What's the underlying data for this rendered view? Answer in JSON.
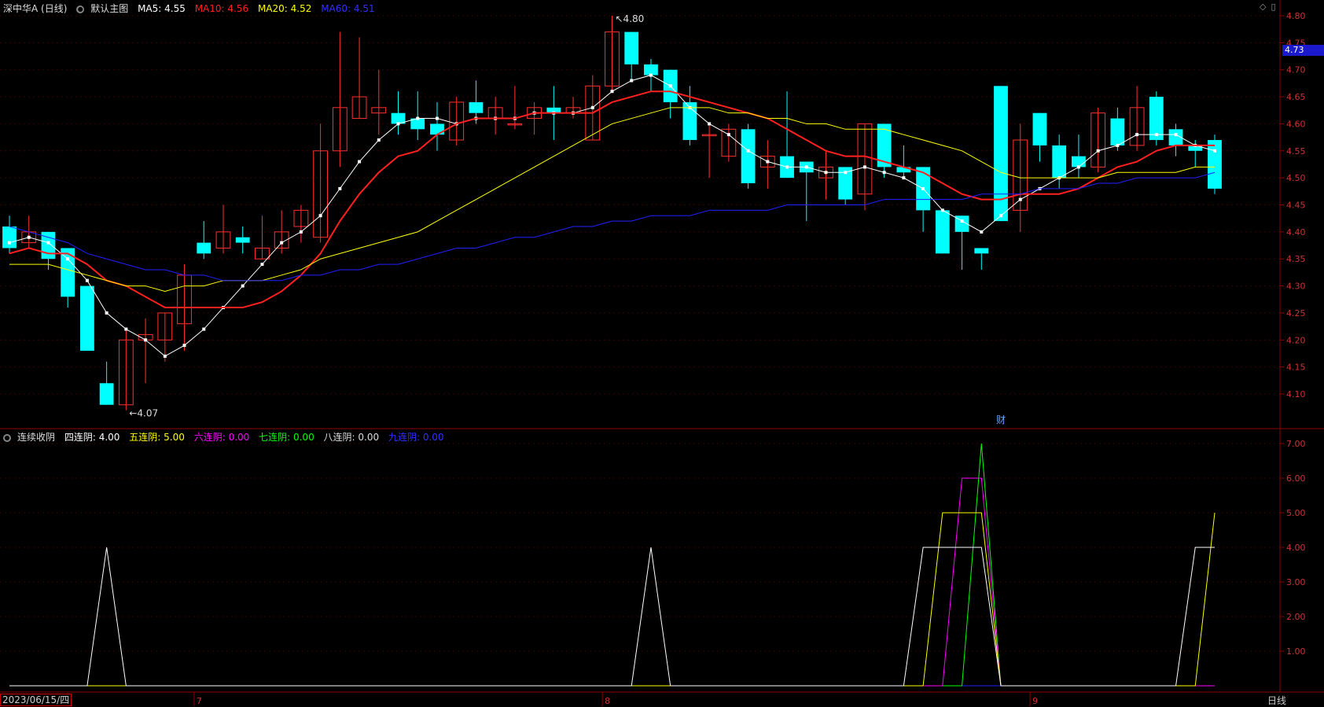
{
  "main": {
    "title": "深中华A (日线)",
    "template": "默认主图",
    "ma": [
      {
        "label": "MA5:",
        "value": "4.55",
        "color": "#ffffff"
      },
      {
        "label": "MA10:",
        "value": "4.56",
        "color": "#ff2020"
      },
      {
        "label": "MA20:",
        "value": "4.52",
        "color": "#ffff00"
      },
      {
        "label": "MA60:",
        "value": "4.51",
        "color": "#2020ff"
      }
    ],
    "current_price_tag": "4.73",
    "finance_marker": "财",
    "high_label": "4.80",
    "low_label": "4.07"
  },
  "indicator": {
    "name": "连续收阴",
    "items": [
      {
        "label": "四连阴:",
        "value": "4.00",
        "color": "#ffffff"
      },
      {
        "label": "五连阴:",
        "value": "5.00",
        "color": "#ffff00"
      },
      {
        "label": "六连阴:",
        "value": "0.00",
        "color": "#ff00ff"
      },
      {
        "label": "七连阴:",
        "value": "0.00",
        "color": "#00ff00"
      },
      {
        "label": "八连阴:",
        "value": "0.00",
        "color": "#ffffff"
      },
      {
        "label": "九连阴:",
        "value": "0.00",
        "color": "#2020ff"
      }
    ]
  },
  "footer": {
    "date": "2023/06/15/四",
    "months": [
      "7",
      "8",
      "9"
    ],
    "period_button": "日线"
  },
  "colors": {
    "up": "#ff3030",
    "down": "#00ffff",
    "grid": "#8b0000",
    "axis_text": "#cc3333"
  },
  "chart_data": [
    {
      "type": "candlestick",
      "title": "深中华A (日线)",
      "ylim": [
        4.07,
        4.8
      ],
      "yticks": [
        "4.80",
        "4.75",
        "4.70",
        "4.65",
        "4.60",
        "4.55",
        "4.50",
        "4.45",
        "4.40",
        "4.35",
        "4.30",
        "4.25",
        "4.20",
        "4.15",
        "4.10"
      ],
      "candles": [
        [
          4.41,
          4.37,
          4.43,
          4.36
        ],
        [
          4.38,
          4.4,
          4.43,
          4.37
        ],
        [
          4.4,
          4.35,
          4.4,
          4.33
        ],
        [
          4.37,
          4.28,
          4.37,
          4.26
        ],
        [
          4.3,
          4.18,
          4.3,
          4.18
        ],
        [
          4.12,
          4.08,
          4.16,
          4.08
        ],
        [
          4.08,
          4.2,
          4.22,
          4.07
        ],
        [
          4.2,
          4.21,
          4.24,
          4.12
        ],
        [
          4.2,
          4.25,
          4.25,
          4.16
        ],
        [
          4.23,
          4.32,
          4.34,
          4.18
        ],
        [
          4.38,
          4.36,
          4.42,
          4.35
        ],
        [
          4.37,
          4.4,
          4.45,
          4.36
        ],
        [
          4.39,
          4.38,
          4.41,
          4.36
        ],
        [
          4.35,
          4.37,
          4.43,
          4.35
        ],
        [
          4.37,
          4.4,
          4.44,
          4.36
        ],
        [
          4.41,
          4.44,
          4.45,
          4.38
        ],
        [
          4.39,
          4.55,
          4.6,
          4.38
        ],
        [
          4.55,
          4.63,
          4.77,
          4.52
        ],
        [
          4.61,
          4.65,
          4.76,
          4.61
        ],
        [
          4.62,
          4.63,
          4.7,
          4.58
        ],
        [
          4.62,
          4.6,
          4.66,
          4.58
        ],
        [
          4.61,
          4.59,
          4.66,
          4.57
        ],
        [
          4.6,
          4.58,
          4.64,
          4.55
        ],
        [
          4.57,
          4.64,
          4.65,
          4.56
        ],
        [
          4.64,
          4.62,
          4.68,
          4.6
        ],
        [
          4.61,
          4.63,
          4.65,
          4.58
        ],
        [
          4.6,
          4.6,
          4.67,
          4.59
        ],
        [
          4.61,
          4.63,
          4.64,
          4.58
        ],
        [
          4.63,
          4.62,
          4.67,
          4.57
        ],
        [
          4.62,
          4.63,
          4.65,
          4.61
        ],
        [
          4.57,
          4.67,
          4.69,
          4.57
        ],
        [
          4.67,
          4.77,
          4.8,
          4.66
        ],
        [
          4.77,
          4.71,
          4.77,
          4.68
        ],
        [
          4.71,
          4.69,
          4.72,
          4.66
        ],
        [
          4.7,
          4.64,
          4.7,
          4.61
        ],
        [
          4.64,
          4.57,
          4.67,
          4.56
        ],
        [
          4.58,
          4.58,
          4.6,
          4.5
        ],
        [
          4.54,
          4.59,
          4.6,
          4.53
        ],
        [
          4.59,
          4.49,
          4.6,
          4.48
        ],
        [
          4.52,
          4.54,
          4.57,
          4.48
        ],
        [
          4.54,
          4.5,
          4.66,
          4.5
        ],
        [
          4.53,
          4.51,
          4.53,
          4.42
        ],
        [
          4.5,
          4.52,
          4.55,
          4.46
        ],
        [
          4.52,
          4.46,
          4.52,
          4.45
        ],
        [
          4.47,
          4.6,
          4.6,
          4.44
        ],
        [
          4.6,
          4.52,
          4.6,
          4.5
        ],
        [
          4.52,
          4.51,
          4.56,
          4.5
        ],
        [
          4.52,
          4.44,
          4.52,
          4.4
        ],
        [
          4.44,
          4.36,
          4.44,
          4.36
        ],
        [
          4.43,
          4.4,
          4.43,
          4.33
        ],
        [
          4.37,
          4.36,
          4.37,
          4.33
        ],
        [
          4.67,
          4.42,
          4.67,
          4.42
        ],
        [
          4.44,
          4.57,
          4.6,
          4.4
        ],
        [
          4.62,
          4.56,
          4.62,
          4.53
        ],
        [
          4.56,
          4.5,
          4.58,
          4.48
        ],
        [
          4.54,
          4.52,
          4.58,
          4.5
        ],
        [
          4.52,
          4.62,
          4.63,
          4.51
        ],
        [
          4.61,
          4.56,
          4.63,
          4.55
        ],
        [
          4.56,
          4.63,
          4.67,
          4.55
        ],
        [
          4.65,
          4.57,
          4.66,
          4.56
        ],
        [
          4.59,
          4.56,
          4.6,
          4.54
        ],
        [
          4.56,
          4.55,
          4.57,
          4.52
        ],
        [
          4.57,
          4.48,
          4.58,
          4.47
        ]
      ],
      "series": [
        {
          "name": "MA5",
          "color": "#ffffff",
          "values": [
            4.38,
            4.39,
            4.38,
            4.35,
            4.31,
            4.25,
            4.22,
            4.2,
            4.17,
            4.19,
            4.22,
            4.26,
            4.3,
            4.34,
            4.38,
            4.4,
            4.43,
            4.48,
            4.53,
            4.57,
            4.6,
            4.61,
            4.61,
            4.6,
            4.61,
            4.61,
            4.61,
            4.62,
            4.62,
            4.62,
            4.63,
            4.66,
            4.68,
            4.69,
            4.67,
            4.63,
            4.6,
            4.58,
            4.55,
            4.53,
            4.52,
            4.52,
            4.51,
            4.51,
            4.52,
            4.51,
            4.5,
            4.48,
            4.44,
            4.42,
            4.4,
            4.43,
            4.46,
            4.48,
            4.5,
            4.52,
            4.55,
            4.56,
            4.58,
            4.58,
            4.58,
            4.56,
            4.55
          ]
        },
        {
          "name": "MA10",
          "color": "#ff2020",
          "values": [
            4.36,
            4.37,
            4.36,
            4.36,
            4.34,
            4.31,
            4.3,
            4.28,
            4.26,
            4.26,
            4.26,
            4.26,
            4.26,
            4.27,
            4.29,
            4.32,
            4.36,
            4.42,
            4.47,
            4.51,
            4.54,
            4.55,
            4.58,
            4.6,
            4.61,
            4.61,
            4.61,
            4.62,
            4.62,
            4.62,
            4.62,
            4.64,
            4.65,
            4.66,
            4.66,
            4.65,
            4.64,
            4.63,
            4.62,
            4.61,
            4.59,
            4.57,
            4.55,
            4.54,
            4.54,
            4.53,
            4.52,
            4.51,
            4.49,
            4.47,
            4.46,
            4.46,
            4.47,
            4.47,
            4.47,
            4.48,
            4.5,
            4.52,
            4.53,
            4.55,
            4.56,
            4.56,
            4.56
          ]
        },
        {
          "name": "MA20",
          "color": "#ffff00",
          "values": [
            4.34,
            4.34,
            4.34,
            4.33,
            4.32,
            4.31,
            4.3,
            4.3,
            4.29,
            4.3,
            4.3,
            4.31,
            4.31,
            4.31,
            4.32,
            4.33,
            4.35,
            4.36,
            4.37,
            4.38,
            4.39,
            4.4,
            4.42,
            4.44,
            4.46,
            4.48,
            4.5,
            4.52,
            4.54,
            4.56,
            4.58,
            4.6,
            4.61,
            4.62,
            4.63,
            4.63,
            4.63,
            4.62,
            4.62,
            4.61,
            4.61,
            4.6,
            4.6,
            4.59,
            4.59,
            4.59,
            4.58,
            4.57,
            4.56,
            4.55,
            4.53,
            4.51,
            4.5,
            4.5,
            4.5,
            4.5,
            4.5,
            4.51,
            4.51,
            4.51,
            4.51,
            4.52,
            4.52
          ]
        },
        {
          "name": "MA60",
          "color": "#2020ff",
          "values": [
            4.41,
            4.4,
            4.39,
            4.38,
            4.36,
            4.35,
            4.34,
            4.33,
            4.33,
            4.32,
            4.32,
            4.31,
            4.31,
            4.31,
            4.31,
            4.32,
            4.32,
            4.33,
            4.33,
            4.34,
            4.34,
            4.35,
            4.36,
            4.37,
            4.37,
            4.38,
            4.39,
            4.39,
            4.4,
            4.41,
            4.41,
            4.42,
            4.42,
            4.43,
            4.43,
            4.43,
            4.44,
            4.44,
            4.44,
            4.44,
            4.45,
            4.45,
            4.45,
            4.45,
            4.45,
            4.46,
            4.46,
            4.46,
            4.46,
            4.46,
            4.47,
            4.47,
            4.47,
            4.48,
            4.48,
            4.48,
            4.49,
            4.49,
            4.5,
            4.5,
            4.5,
            4.5,
            4.51
          ]
        }
      ]
    },
    {
      "type": "line",
      "title": "连续收阴",
      "ylim": [
        0,
        7.5
      ],
      "yticks": [
        "7.00",
        "6.00",
        "5.00",
        "4.00",
        "3.00",
        "2.00",
        "1.00"
      ],
      "series": [
        {
          "name": "四连阴",
          "color": "#ffffff",
          "values": [
            0,
            0,
            0,
            0,
            0,
            4,
            0,
            0,
            0,
            0,
            0,
            0,
            0,
            0,
            0,
            0,
            0,
            0,
            0,
            0,
            0,
            0,
            0,
            0,
            0,
            0,
            0,
            0,
            0,
            0,
            0,
            0,
            0,
            4,
            0,
            0,
            0,
            0,
            0,
            0,
            0,
            0,
            0,
            0,
            0,
            0,
            0,
            4,
            4,
            4,
            4,
            0,
            0,
            0,
            0,
            0,
            0,
            0,
            0,
            0,
            0,
            4,
            4
          ]
        },
        {
          "name": "五连阴",
          "color": "#ffff00",
          "values": [
            0,
            0,
            0,
            0,
            0,
            0,
            0,
            0,
            0,
            0,
            0,
            0,
            0,
            0,
            0,
            0,
            0,
            0,
            0,
            0,
            0,
            0,
            0,
            0,
            0,
            0,
            0,
            0,
            0,
            0,
            0,
            0,
            0,
            0,
            0,
            0,
            0,
            0,
            0,
            0,
            0,
            0,
            0,
            0,
            0,
            0,
            0,
            0,
            5,
            5,
            5,
            0,
            0,
            0,
            0,
            0,
            0,
            0,
            0,
            0,
            0,
            0,
            5
          ]
        },
        {
          "name": "六连阴",
          "color": "#ff00ff",
          "values": [
            0,
            0,
            0,
            0,
            0,
            0,
            0,
            0,
            0,
            0,
            0,
            0,
            0,
            0,
            0,
            0,
            0,
            0,
            0,
            0,
            0,
            0,
            0,
            0,
            0,
            0,
            0,
            0,
            0,
            0,
            0,
            0,
            0,
            0,
            0,
            0,
            0,
            0,
            0,
            0,
            0,
            0,
            0,
            0,
            0,
            0,
            0,
            0,
            0,
            6,
            6,
            0,
            0,
            0,
            0,
            0,
            0,
            0,
            0,
            0,
            0,
            0,
            0
          ]
        },
        {
          "name": "七连阴",
          "color": "#00ff00",
          "values": [
            0,
            0,
            0,
            0,
            0,
            0,
            0,
            0,
            0,
            0,
            0,
            0,
            0,
            0,
            0,
            0,
            0,
            0,
            0,
            0,
            0,
            0,
            0,
            0,
            0,
            0,
            0,
            0,
            0,
            0,
            0,
            0,
            0,
            0,
            0,
            0,
            0,
            0,
            0,
            0,
            0,
            0,
            0,
            0,
            0,
            0,
            0,
            0,
            0,
            0,
            7,
            0,
            0,
            0,
            0,
            0,
            0,
            0,
            0,
            0,
            0,
            0,
            0
          ]
        },
        {
          "name": "九连阴",
          "color": "#2020ff",
          "values": [
            0,
            0,
            0,
            0,
            0,
            0,
            0,
            0,
            0,
            0,
            0,
            0,
            0,
            0,
            0,
            0,
            0,
            0,
            0,
            0,
            0,
            0,
            0,
            0,
            0,
            0,
            0,
            0,
            0,
            0,
            0,
            0,
            0,
            0,
            0,
            0,
            0,
            0,
            0,
            0,
            0,
            0,
            0,
            0,
            0,
            0,
            0,
            0,
            0,
            0,
            0,
            0,
            0,
            0,
            0,
            0,
            0,
            0,
            0,
            0,
            0,
            0,
            0
          ]
        }
      ]
    }
  ]
}
